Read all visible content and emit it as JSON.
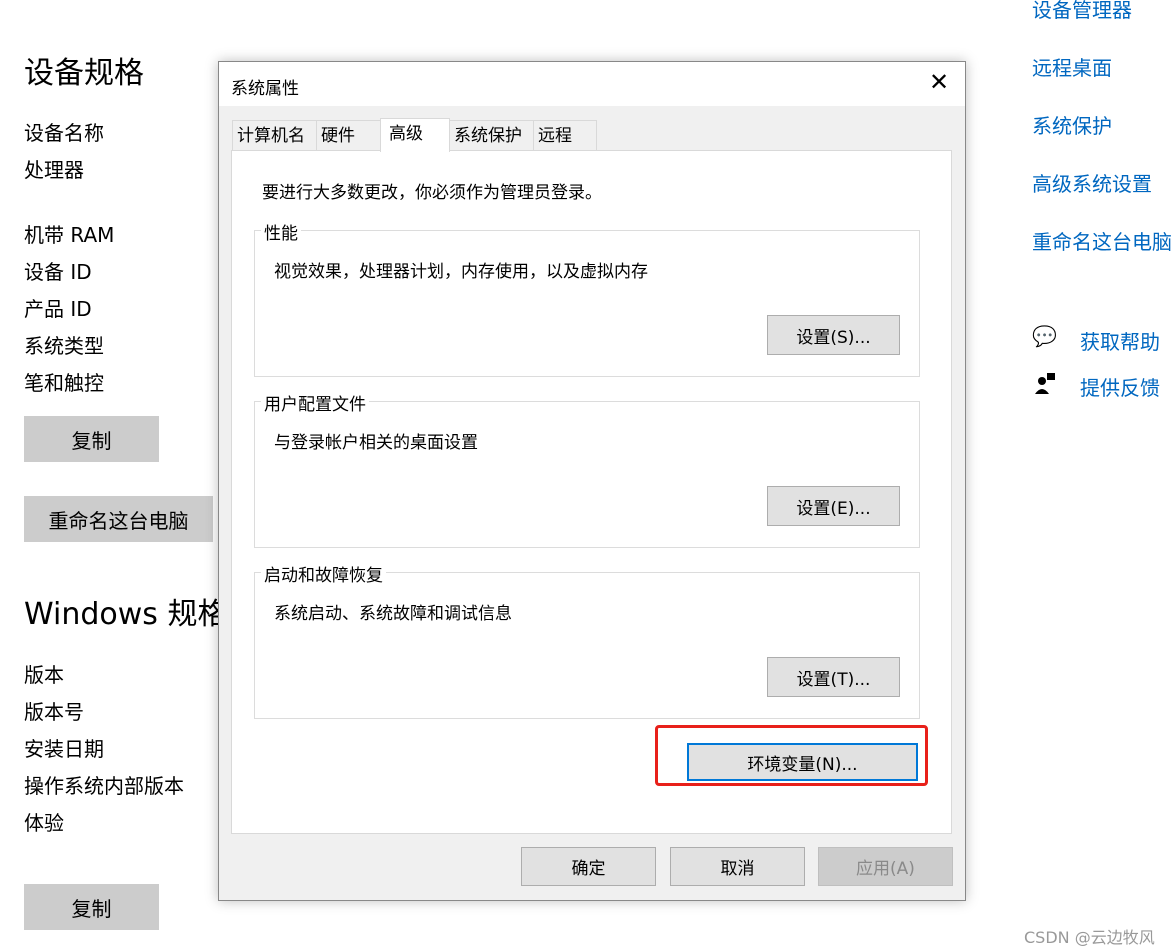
{
  "page": {
    "device_heading": "设备规格",
    "device_labels": [
      "设备名称",
      "处理器",
      "机带 RAM",
      "设备 ID",
      "产品 ID",
      "系统类型",
      "笔和触控"
    ],
    "copy_label": "复制",
    "rename_label": "重命名这台电脑",
    "windows_heading": "Windows 规格",
    "windows_labels": [
      "版本",
      "版本号",
      "安装日期",
      "操作系统内部版本",
      "体验"
    ],
    "copy2_label": "复制"
  },
  "right_links": [
    "设备管理器",
    "远程桌面",
    "系统保护",
    "高级系统设置",
    "重命名这台电脑"
  ],
  "help": {
    "get_help": "获取帮助",
    "feedback": "提供反馈"
  },
  "dialog": {
    "title": "系统属性",
    "tabs": [
      "计算机名",
      "硬件",
      "高级",
      "系统保护",
      "远程"
    ],
    "admin_note": "要进行大多数更改，你必须作为管理员登录。",
    "groups": [
      {
        "legend": "性能",
        "desc": "视觉效果，处理器计划，内存使用，以及虚拟内存",
        "button": "设置(S)..."
      },
      {
        "legend": "用户配置文件",
        "desc": "与登录帐户相关的桌面设置",
        "button": "设置(E)..."
      },
      {
        "legend": "启动和故障恢复",
        "desc": "系统启动、系统故障和调试信息",
        "button": "设置(T)..."
      }
    ],
    "env_button": "环境变量(N)...",
    "ok": "确定",
    "cancel": "取消",
    "apply": "应用(A)"
  },
  "highlight_color": "#e8201a",
  "watermark": "CSDN @云边牧风"
}
